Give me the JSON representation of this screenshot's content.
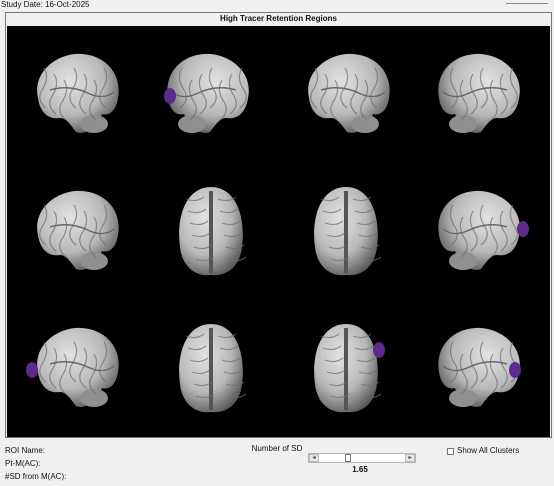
{
  "header": {
    "study_date": "Study Date:  16-Oct-2025"
  },
  "panel": {
    "title": "High Tracer Retention Regions"
  },
  "viewer": {
    "views": [
      {
        "view": "left-lateral",
        "highlight": false
      },
      {
        "view": "right-medial",
        "highlight": true
      },
      {
        "view": "left-medial",
        "highlight": false
      },
      {
        "view": "right-lateral",
        "highlight": false
      },
      {
        "view": "left-lateral-tilted",
        "highlight": false
      },
      {
        "view": "inferior",
        "highlight": false
      },
      {
        "view": "superior",
        "highlight": false
      },
      {
        "view": "right-lateral-tilted",
        "highlight": true
      },
      {
        "view": "left-anterior",
        "highlight": true
      },
      {
        "view": "inferior-2",
        "highlight": false
      },
      {
        "view": "posterior",
        "highlight": true
      },
      {
        "view": "right-posterior",
        "highlight": true
      }
    ],
    "highlight_color": "#5b2a8c",
    "brain_color": "#b9b9b9"
  },
  "info": {
    "roi_name_label": "ROI Name:",
    "pt_label": "Pt-M(AC):",
    "sd_label": "#SD from M(AC):"
  },
  "slider": {
    "title": "Number of SD",
    "value": "1.65",
    "left_arrow": "◂",
    "right_arrow": "▸",
    "fraction": 0.33
  },
  "clusters": {
    "label": "Show All Clusters",
    "checked": false
  }
}
